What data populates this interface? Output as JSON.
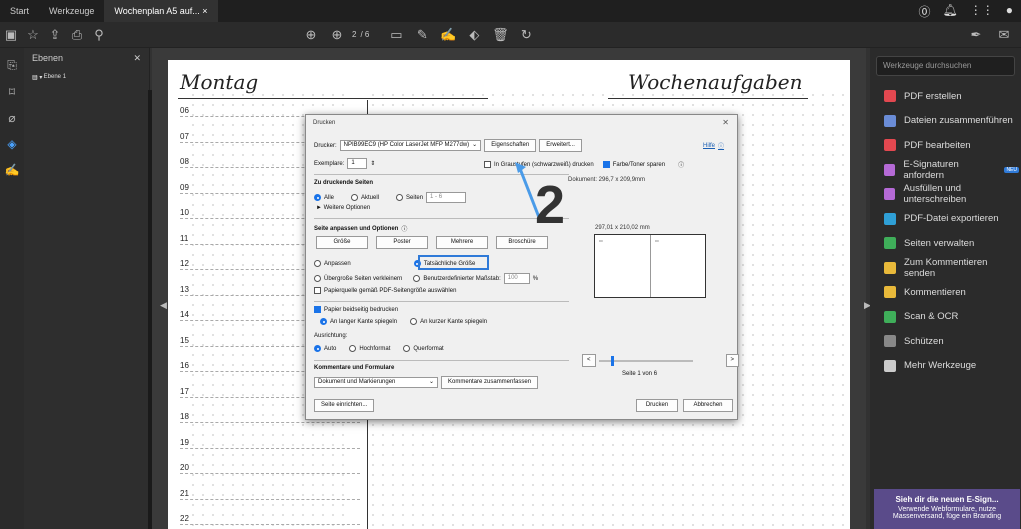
{
  "tabs": [
    "Start",
    "Werkzeuge",
    "Wochenplan A5 auf..."
  ],
  "toolbar": {
    "page_current": "2",
    "page_total": "/ 6"
  },
  "layers": {
    "title": "Ebenen",
    "item": "Ebene 1"
  },
  "planner": {
    "day_title": "Montag",
    "week_title": "Wochenaufgaben",
    "hours": [
      "06",
      "07",
      "08",
      "09",
      "10",
      "11",
      "12",
      "13",
      "14",
      "15",
      "16",
      "17",
      "18",
      "19",
      "20",
      "21",
      "22"
    ]
  },
  "right_panel": {
    "search": "Werkzeuge durchsuchen",
    "items": [
      {
        "label": "PDF erstellen",
        "color": "#e34850"
      },
      {
        "label": "Dateien zusammenführen",
        "color": "#6a8cd6"
      },
      {
        "label": "PDF bearbeiten",
        "color": "#e34850"
      },
      {
        "label": "E-Signaturen anfordern",
        "color": "#b56ad6"
      },
      {
        "label": "Ausfüllen und unterschreiben",
        "color": "#b56ad6"
      },
      {
        "label": "PDF-Datei exportieren",
        "color": "#2f9fd6"
      },
      {
        "label": "Seiten verwalten",
        "color": "#3fae5a"
      },
      {
        "label": "Zum Kommentieren senden",
        "color": "#e8b93a"
      },
      {
        "label": "Kommentieren",
        "color": "#e8b93a"
      },
      {
        "label": "Scan & OCR",
        "color": "#3fae5a"
      },
      {
        "label": "Schützen",
        "color": "#888888"
      },
      {
        "label": "Mehr Werkzeuge",
        "color": "#cccccc"
      }
    ],
    "badge": "NEU",
    "promo_title": "Sieh dir die neuen E-Sign...",
    "promo_text": "Verwende Webformulare, nutze Massenversand, füge ein Branding"
  },
  "dialog": {
    "title": "Drucken",
    "printer_label": "Drucker:",
    "printer_value": "NPIB99EC9 (HP Color LaserJet MFP M277dw)",
    "properties": "Eigenschaften",
    "advanced": "Erweitert...",
    "help": "Hilfe",
    "copies_label": "Exemplare:",
    "copies_value": "1",
    "grayscale": "In Graustufen (schwarzweiß) drucken",
    "save_toner": "Farbe/Toner sparen",
    "pages_section": "Zu druckende Seiten",
    "all": "Alle",
    "current": "Aktuell",
    "pages": "Seiten",
    "pages_value": "1 - 6",
    "more_options": "► Weitere Optionen",
    "sizing_section": "Seite anpassen und Optionen",
    "size_btn": "Größe",
    "poster_btn": "Poster",
    "multiple_btn": "Mehrere",
    "booklet_btn": "Broschüre",
    "fit": "Anpassen",
    "actual": "Tatsächliche Größe",
    "shrink": "Übergroße Seiten verkleinern",
    "custom": "Benutzerdefinierter Maßstab:",
    "scale_value": "100",
    "scale_unit": "%",
    "paper_source": "Papierquelle gemäß PDF-Seitengröße auswählen",
    "duplex": "Papier beidseitig bedrucken",
    "long_edge": "An langer Kante spiegeln",
    "short_edge": "An kurzer Kante spiegeln",
    "orientation": "Ausrichtung:",
    "auto": "Auto",
    "portrait": "Hochformat",
    "landscape": "Querformat",
    "comments_section": "Kommentare und Formulare",
    "comments_value": "Dokument und Markierungen",
    "summarize": "Kommentare zusammenfassen",
    "document_size": "Dokument: 296,7 x 209,9mm",
    "preview_size": "297,01 x 210,02 mm",
    "page_of": "Seite 1 von 6",
    "page_setup": "Seite einrichten...",
    "print": "Drucken",
    "cancel": "Abbrechen"
  },
  "annotation": {
    "step_number": "2",
    "accent": "#2f7ad8"
  }
}
